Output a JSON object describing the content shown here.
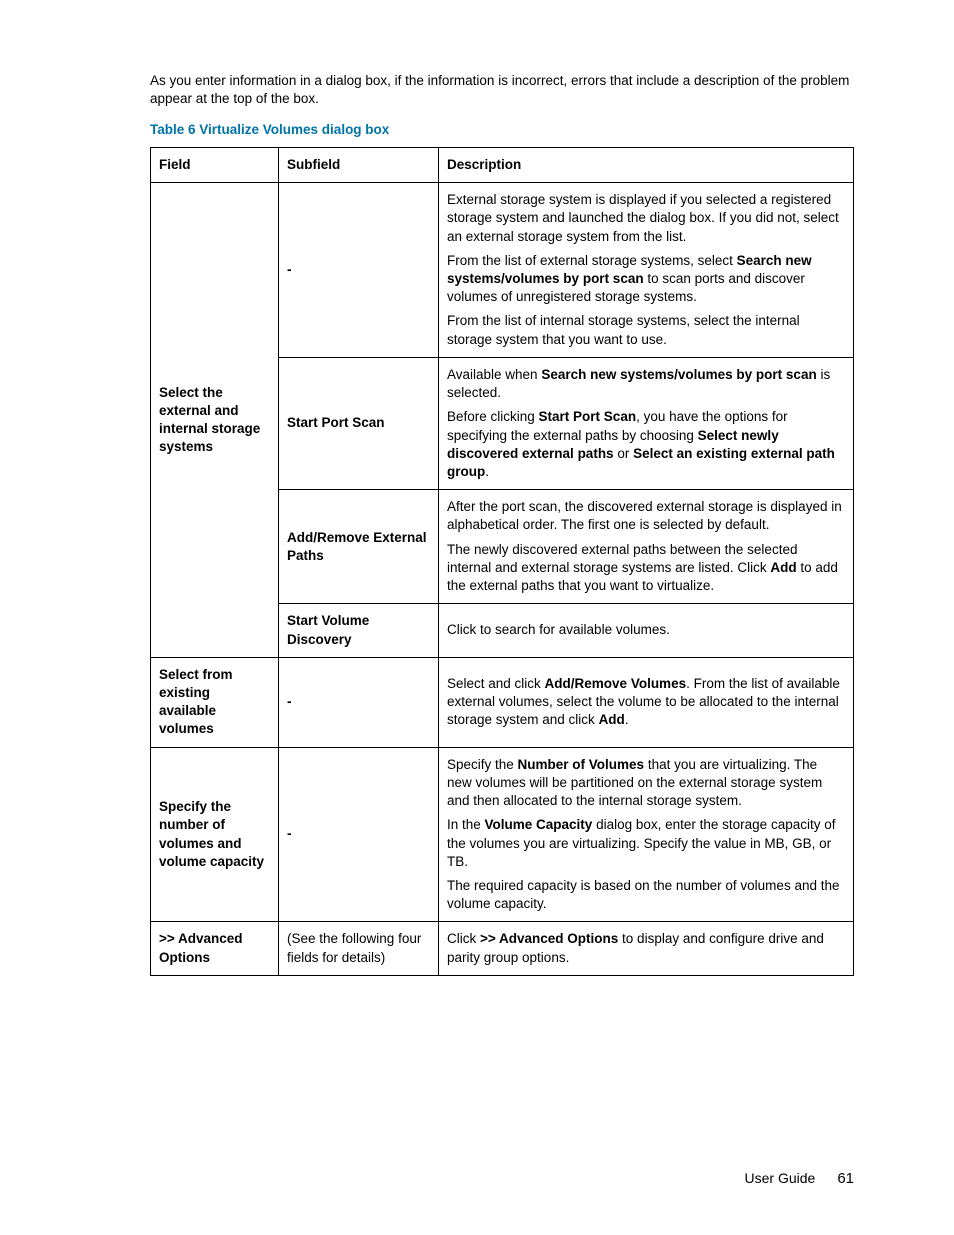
{
  "intro": "As you enter information in a dialog box, if the information is incorrect, errors that include a description of the problem appear at the top of the box.",
  "caption": "Table 6 Virtualize Volumes dialog box",
  "headers": {
    "field": "Field",
    "subfield": "Subfield",
    "description": "Description"
  },
  "rows": {
    "r1": {
      "field": "Select the external and internal storage systems",
      "subfield": "-",
      "p1a": "External storage system is displayed if you selected a registered storage system and launched the dialog box. If you did not, select an external storage system from the list.",
      "p2a": "From the list of external storage systems, select ",
      "p2b": "Search new systems/volumes by port scan",
      "p2c": " to scan ports and discover volumes of unregistered storage systems.",
      "p3a": "From the list of internal storage systems, select the internal storage system that you want to use."
    },
    "r2": {
      "subfield": "Start Port Scan",
      "p1a": "Available when ",
      "p1b": "Search new systems/volumes by port scan",
      "p1c": " is selected.",
      "p2a": "Before clicking ",
      "p2b": "Start Port Scan",
      "p2c": ", you have the options for specifying the external paths by choosing ",
      "p2d": "Select newly discovered external paths",
      "p2e": " or ",
      "p2f": "Select an existing external path group",
      "p2g": "."
    },
    "r3": {
      "subfield": "Add/Remove External Paths",
      "p1a": "After the port scan, the discovered external storage is displayed in alphabetical order. The first one is selected by default.",
      "p2a": "The newly discovered external paths between the selected internal and external storage systems are listed. Click ",
      "p2b": "Add",
      "p2c": " to add the external paths that you want to virtualize."
    },
    "r4": {
      "subfield": "Start Volume Discovery",
      "p1a": "Click to search for available volumes."
    },
    "r5": {
      "field": "Select from existing available volumes",
      "subfield": "-",
      "p1a": "Select and click ",
      "p1b": "Add/Remove Volumes",
      "p1c": ". From the list of available external volumes, select the volume to be allocated to the internal storage system and click ",
      "p1d": "Add",
      "p1e": "."
    },
    "r6": {
      "field": "Specify the number of volumes and volume capacity",
      "subfield": "-",
      "p1a": "Specify the ",
      "p1b": "Number of Volumes",
      "p1c": " that you are virtualizing. The new volumes will be partitioned on the external storage system and then allocated to the internal storage system.",
      "p2a": "In the ",
      "p2b": "Volume Capacity",
      "p2c": " dialog box, enter the storage capacity of the volumes you are virtualizing. Specify the value in MB, GB, or TB.",
      "p3a": "The required capacity is based on the number of volumes and the volume capacity."
    },
    "r7": {
      "field": ">> Advanced Options",
      "subfield": "(See the following four fields for details)",
      "p1a": "Click ",
      "p1b": ">> Advanced Options",
      "p1c": " to display and configure drive and parity group options."
    }
  },
  "footer": {
    "label": "User Guide",
    "page": "61"
  }
}
